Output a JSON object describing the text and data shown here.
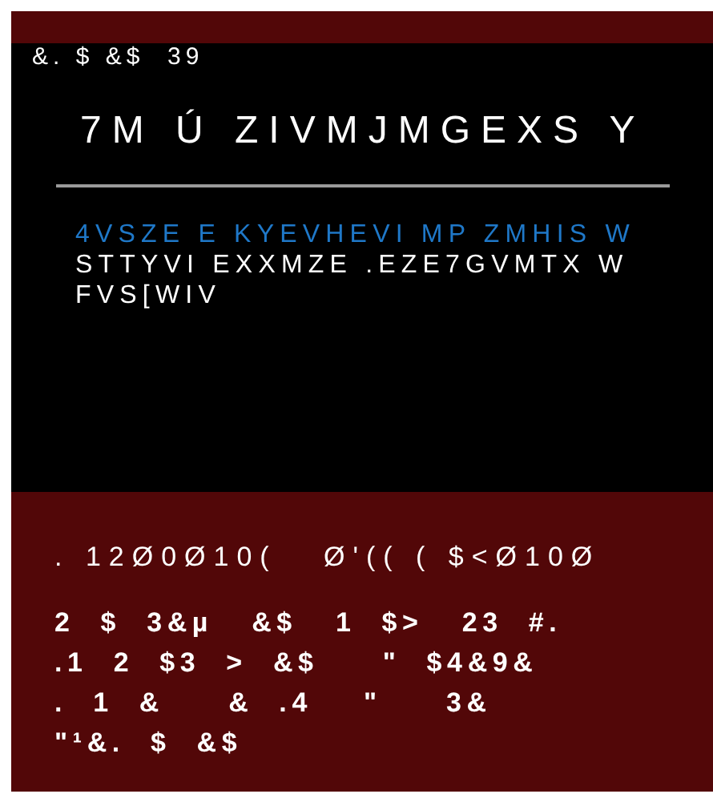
{
  "header": {
    "label": "&. $ &$  39"
  },
  "title": "7M Ú ZIVMJMGEXS Y",
  "notice": {
    "link": "4VSZE E KYEVHEVI MP ZMHIS W",
    "lines": [
      "STTYVI EXXMZE .EZE7GVMTX W",
      "FVS[WIV"
    ]
  },
  "footer": {
    "heading": ". 12Ø0Ø10(   Ø'(( ( $<Ø10Ø",
    "lines": [
      "2  $  3&µ   &$   1  $>   23  #.",
      ".1  2  $3  >  &$     \"  $4&9&",
      ".  1  &     &  .4    \"     3&",
      "\"¹&.  $  &$"
    ]
  }
}
